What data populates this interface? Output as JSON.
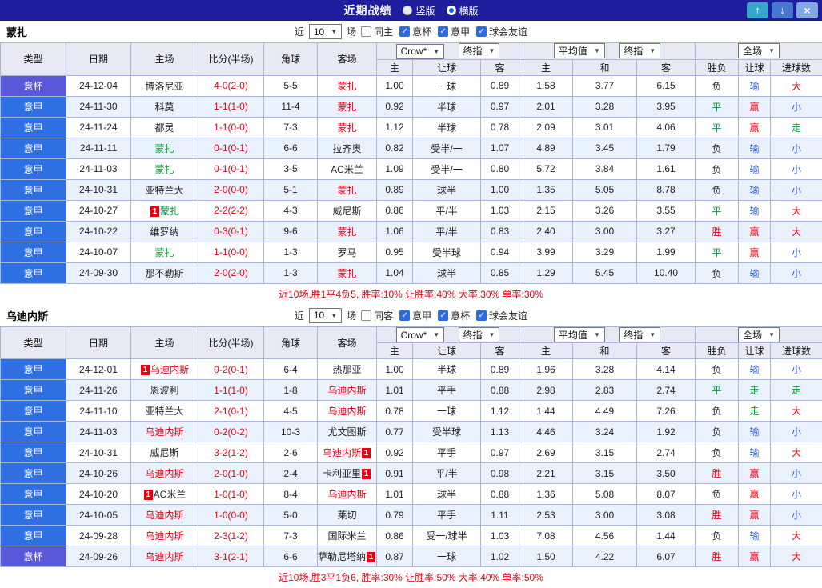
{
  "topbar": {
    "title": "近期战绩",
    "radios": [
      {
        "label": "竖版",
        "selected": false
      },
      {
        "label": "横版",
        "selected": true
      }
    ],
    "buttons": {
      "up": "↑",
      "down": "↓",
      "close": "×"
    }
  },
  "columns": [
    "类型",
    "日期",
    "主场",
    "比分(半场)",
    "角球",
    "客场",
    "主",
    "让球",
    "客",
    "主",
    "和",
    "客",
    "胜负",
    "让球",
    "进球数"
  ],
  "dropdowns": {
    "bookmaker": "Crow*",
    "asian_stage": "终指",
    "euro_avg": "平均值",
    "euro_stage": "终指",
    "scope": "全场"
  },
  "colors": {
    "topbar_navy": "#1e1e9c",
    "league_blue": "#2e6fe2",
    "cup_purple": "#5a57d8",
    "win_red": "#e60012",
    "draw_green": "#089a39",
    "lose_blue": "#2d5be0",
    "alt_row": "#e9f2fc",
    "header_bg": "#e9e9f5"
  },
  "sections": [
    {
      "team": "蒙扎",
      "filter": {
        "near": "近",
        "count": "10",
        "unit": "场",
        "checkboxes": [
          {
            "label": "同主",
            "checked": false
          },
          {
            "label": "意杯",
            "checked": true
          },
          {
            "label": "意甲",
            "checked": true
          },
          {
            "label": "球会友谊",
            "checked": true
          }
        ]
      },
      "rows": [
        {
          "type": "意杯",
          "date": "24-12-04",
          "home": {
            "name": "博洛尼亚",
            "color": "black"
          },
          "score": "4-0(2-0)",
          "corner": "5-5",
          "away": {
            "name": "蒙扎",
            "color": "red"
          },
          "asian": {
            "h": "1.00",
            "line": "一球",
            "a": "0.89"
          },
          "euro": {
            "h": "1.58",
            "d": "3.77",
            "a": "6.15"
          },
          "res": {
            "wdl": "负",
            "wdlc": "black",
            "let": "输",
            "letc": "blue",
            "goal": "大",
            "goalc": "red"
          }
        },
        {
          "type": "意甲",
          "date": "24-11-30",
          "home": {
            "name": "科莫",
            "color": "black"
          },
          "score": "1-1(1-0)",
          "corner": "11-4",
          "away": {
            "name": "蒙扎",
            "color": "red"
          },
          "asian": {
            "h": "0.92",
            "line": "半球",
            "a": "0.97"
          },
          "euro": {
            "h": "2.01",
            "d": "3.28",
            "a": "3.95"
          },
          "res": {
            "wdl": "平",
            "wdlc": "green",
            "let": "赢",
            "letc": "red",
            "goal": "小",
            "goalc": "blue"
          }
        },
        {
          "type": "意甲",
          "date": "24-11-24",
          "home": {
            "name": "都灵",
            "color": "black"
          },
          "score": "1-1(0-0)",
          "corner": "7-3",
          "away": {
            "name": "蒙扎",
            "color": "red"
          },
          "asian": {
            "h": "1.12",
            "line": "半球",
            "a": "0.78"
          },
          "euro": {
            "h": "2.09",
            "d": "3.01",
            "a": "4.06"
          },
          "res": {
            "wdl": "平",
            "wdlc": "green",
            "let": "赢",
            "letc": "red",
            "goal": "走",
            "goalc": "green"
          }
        },
        {
          "type": "意甲",
          "date": "24-11-11",
          "home": {
            "name": "蒙扎",
            "color": "green"
          },
          "score": "0-1(0-1)",
          "corner": "6-6",
          "away": {
            "name": "拉齐奥",
            "color": "black"
          },
          "asian": {
            "h": "0.82",
            "line": "受半/一",
            "a": "1.07"
          },
          "euro": {
            "h": "4.89",
            "d": "3.45",
            "a": "1.79"
          },
          "res": {
            "wdl": "负",
            "wdlc": "black",
            "let": "输",
            "letc": "blue",
            "goal": "小",
            "goalc": "blue"
          }
        },
        {
          "type": "意甲",
          "date": "24-11-03",
          "home": {
            "name": "蒙扎",
            "color": "green"
          },
          "score": "0-1(0-1)",
          "corner": "3-5",
          "away": {
            "name": "AC米兰",
            "color": "black"
          },
          "asian": {
            "h": "1.09",
            "line": "受半/一",
            "a": "0.80"
          },
          "euro": {
            "h": "5.72",
            "d": "3.84",
            "a": "1.61"
          },
          "res": {
            "wdl": "负",
            "wdlc": "black",
            "let": "输",
            "letc": "blue",
            "goal": "小",
            "goalc": "blue"
          }
        },
        {
          "type": "意甲",
          "date": "24-10-31",
          "home": {
            "name": "亚特兰大",
            "color": "black"
          },
          "score": "2-0(0-0)",
          "corner": "5-1",
          "away": {
            "name": "蒙扎",
            "color": "red"
          },
          "asian": {
            "h": "0.89",
            "line": "球半",
            "a": "1.00"
          },
          "euro": {
            "h": "1.35",
            "d": "5.05",
            "a": "8.78"
          },
          "res": {
            "wdl": "负",
            "wdlc": "black",
            "let": "输",
            "letc": "blue",
            "goal": "小",
            "goalc": "blue"
          }
        },
        {
          "type": "意甲",
          "date": "24-10-27",
          "home": {
            "name": "蒙扎",
            "color": "green",
            "badge": "before"
          },
          "score": "2-2(2-2)",
          "corner": "4-3",
          "away": {
            "name": "威尼斯",
            "color": "black"
          },
          "asian": {
            "h": "0.86",
            "line": "平/半",
            "a": "1.03"
          },
          "euro": {
            "h": "2.15",
            "d": "3.26",
            "a": "3.55"
          },
          "res": {
            "wdl": "平",
            "wdlc": "green",
            "let": "输",
            "letc": "blue",
            "goal": "大",
            "goalc": "red"
          }
        },
        {
          "type": "意甲",
          "date": "24-10-22",
          "home": {
            "name": "维罗纳",
            "color": "black"
          },
          "score": "0-3(0-1)",
          "corner": "9-6",
          "away": {
            "name": "蒙扎",
            "color": "red"
          },
          "asian": {
            "h": "1.06",
            "line": "平/半",
            "a": "0.83"
          },
          "euro": {
            "h": "2.40",
            "d": "3.00",
            "a": "3.27"
          },
          "res": {
            "wdl": "胜",
            "wdlc": "red",
            "let": "赢",
            "letc": "red",
            "goal": "大",
            "goalc": "red"
          }
        },
        {
          "type": "意甲",
          "date": "24-10-07",
          "home": {
            "name": "蒙扎",
            "color": "green"
          },
          "score": "1-1(0-0)",
          "corner": "1-3",
          "away": {
            "name": "罗马",
            "color": "black"
          },
          "asian": {
            "h": "0.95",
            "line": "受半球",
            "a": "0.94"
          },
          "euro": {
            "h": "3.99",
            "d": "3.29",
            "a": "1.99"
          },
          "res": {
            "wdl": "平",
            "wdlc": "green",
            "let": "赢",
            "letc": "red",
            "goal": "小",
            "goalc": "blue"
          }
        },
        {
          "type": "意甲",
          "date": "24-09-30",
          "home": {
            "name": "那不勒斯",
            "color": "black"
          },
          "score": "2-0(2-0)",
          "corner": "1-3",
          "away": {
            "name": "蒙扎",
            "color": "red"
          },
          "asian": {
            "h": "1.04",
            "line": "球半",
            "a": "0.85"
          },
          "euro": {
            "h": "1.29",
            "d": "5.45",
            "a": "10.40"
          },
          "res": {
            "wdl": "负",
            "wdlc": "black",
            "let": "输",
            "letc": "blue",
            "goal": "小",
            "goalc": "blue"
          }
        }
      ],
      "summary": "近10场,胜1平4负5, 胜率:10% 让胜率:40% 大率:30% 单率:30%"
    },
    {
      "team": "乌迪内斯",
      "filter": {
        "near": "近",
        "count": "10",
        "unit": "场",
        "checkboxes": [
          {
            "label": "同客",
            "checked": false
          },
          {
            "label": "意甲",
            "checked": true
          },
          {
            "label": "意杯",
            "checked": true
          },
          {
            "label": "球会友谊",
            "checked": true
          }
        ]
      },
      "rows": [
        {
          "type": "意甲",
          "date": "24-12-01",
          "home": {
            "name": "乌迪内斯",
            "color": "red",
            "badge": "before"
          },
          "score": "0-2(0-1)",
          "corner": "6-4",
          "away": {
            "name": "热那亚",
            "color": "black"
          },
          "asian": {
            "h": "1.00",
            "line": "半球",
            "a": "0.89"
          },
          "euro": {
            "h": "1.96",
            "d": "3.28",
            "a": "4.14"
          },
          "res": {
            "wdl": "负",
            "wdlc": "black",
            "let": "输",
            "letc": "blue",
            "goal": "小",
            "goalc": "blue"
          }
        },
        {
          "type": "意甲",
          "date": "24-11-26",
          "home": {
            "name": "恩波利",
            "color": "black"
          },
          "score": "1-1(1-0)",
          "corner": "1-8",
          "away": {
            "name": "乌迪内斯",
            "color": "red"
          },
          "asian": {
            "h": "1.01",
            "line": "平手",
            "a": "0.88"
          },
          "euro": {
            "h": "2.98",
            "d": "2.83",
            "a": "2.74"
          },
          "res": {
            "wdl": "平",
            "wdlc": "green",
            "let": "走",
            "letc": "green",
            "goal": "走",
            "goalc": "green"
          }
        },
        {
          "type": "意甲",
          "date": "24-11-10",
          "home": {
            "name": "亚特兰大",
            "color": "black"
          },
          "score": "2-1(0-1)",
          "corner": "4-5",
          "away": {
            "name": "乌迪内斯",
            "color": "red"
          },
          "asian": {
            "h": "0.78",
            "line": "一球",
            "a": "1.12"
          },
          "euro": {
            "h": "1.44",
            "d": "4.49",
            "a": "7.26"
          },
          "res": {
            "wdl": "负",
            "wdlc": "black",
            "let": "走",
            "letc": "green",
            "goal": "大",
            "goalc": "red"
          }
        },
        {
          "type": "意甲",
          "date": "24-11-03",
          "home": {
            "name": "乌迪内斯",
            "color": "red"
          },
          "score": "0-2(0-2)",
          "corner": "10-3",
          "away": {
            "name": "尤文图斯",
            "color": "black"
          },
          "asian": {
            "h": "0.77",
            "line": "受半球",
            "a": "1.13"
          },
          "euro": {
            "h": "4.46",
            "d": "3.24",
            "a": "1.92"
          },
          "res": {
            "wdl": "负",
            "wdlc": "black",
            "let": "输",
            "letc": "blue",
            "goal": "小",
            "goalc": "blue"
          }
        },
        {
          "type": "意甲",
          "date": "24-10-31",
          "home": {
            "name": "威尼斯",
            "color": "black"
          },
          "score": "3-2(1-2)",
          "corner": "2-6",
          "away": {
            "name": "乌迪内斯",
            "color": "red",
            "badge": "after"
          },
          "asian": {
            "h": "0.92",
            "line": "平手",
            "a": "0.97"
          },
          "euro": {
            "h": "2.69",
            "d": "3.15",
            "a": "2.74"
          },
          "res": {
            "wdl": "负",
            "wdlc": "black",
            "let": "输",
            "letc": "blue",
            "goal": "大",
            "goalc": "red"
          }
        },
        {
          "type": "意甲",
          "date": "24-10-26",
          "home": {
            "name": "乌迪内斯",
            "color": "red"
          },
          "score": "2-0(1-0)",
          "corner": "2-4",
          "away": {
            "name": "卡利亚里",
            "color": "black",
            "badge": "after"
          },
          "asian": {
            "h": "0.91",
            "line": "平/半",
            "a": "0.98"
          },
          "euro": {
            "h": "2.21",
            "d": "3.15",
            "a": "3.50"
          },
          "res": {
            "wdl": "胜",
            "wdlc": "red",
            "let": "赢",
            "letc": "red",
            "goal": "小",
            "goalc": "blue"
          }
        },
        {
          "type": "意甲",
          "date": "24-10-20",
          "home": {
            "name": "AC米兰",
            "color": "black",
            "badge": "before"
          },
          "score": "1-0(1-0)",
          "corner": "8-4",
          "away": {
            "name": "乌迪内斯",
            "color": "red"
          },
          "asian": {
            "h": "1.01",
            "line": "球半",
            "a": "0.88"
          },
          "euro": {
            "h": "1.36",
            "d": "5.08",
            "a": "8.07"
          },
          "res": {
            "wdl": "负",
            "wdlc": "black",
            "let": "赢",
            "letc": "red",
            "goal": "小",
            "goalc": "blue"
          }
        },
        {
          "type": "意甲",
          "date": "24-10-05",
          "home": {
            "name": "乌迪内斯",
            "color": "red"
          },
          "score": "1-0(0-0)",
          "corner": "5-0",
          "away": {
            "name": "莱切",
            "color": "black"
          },
          "asian": {
            "h": "0.79",
            "line": "平手",
            "a": "1.11"
          },
          "euro": {
            "h": "2.53",
            "d": "3.00",
            "a": "3.08"
          },
          "res": {
            "wdl": "胜",
            "wdlc": "red",
            "let": "赢",
            "letc": "red",
            "goal": "小",
            "goalc": "blue"
          }
        },
        {
          "type": "意甲",
          "date": "24-09-28",
          "home": {
            "name": "乌迪内斯",
            "color": "red"
          },
          "score": "2-3(1-2)",
          "corner": "7-3",
          "away": {
            "name": "国际米兰",
            "color": "black"
          },
          "asian": {
            "h": "0.86",
            "line": "受一/球半",
            "a": "1.03"
          },
          "euro": {
            "h": "7.08",
            "d": "4.56",
            "a": "1.44"
          },
          "res": {
            "wdl": "负",
            "wdlc": "black",
            "let": "输",
            "letc": "blue",
            "goal": "大",
            "goalc": "red"
          }
        },
        {
          "type": "意杯",
          "date": "24-09-26",
          "home": {
            "name": "乌迪内斯",
            "color": "red"
          },
          "score": "3-1(2-1)",
          "corner": "6-6",
          "away": {
            "name": "萨勒尼塔纳",
            "color": "black",
            "badge": "after"
          },
          "asian": {
            "h": "0.87",
            "line": "一球",
            "a": "1.02"
          },
          "euro": {
            "h": "1.50",
            "d": "4.22",
            "a": "6.07"
          },
          "res": {
            "wdl": "胜",
            "wdlc": "red",
            "let": "赢",
            "letc": "red",
            "goal": "大",
            "goalc": "red"
          }
        }
      ],
      "summary": "近10场,胜3平1负6, 胜率:30% 让胜率:50% 大率:40% 单率:50%"
    }
  ]
}
